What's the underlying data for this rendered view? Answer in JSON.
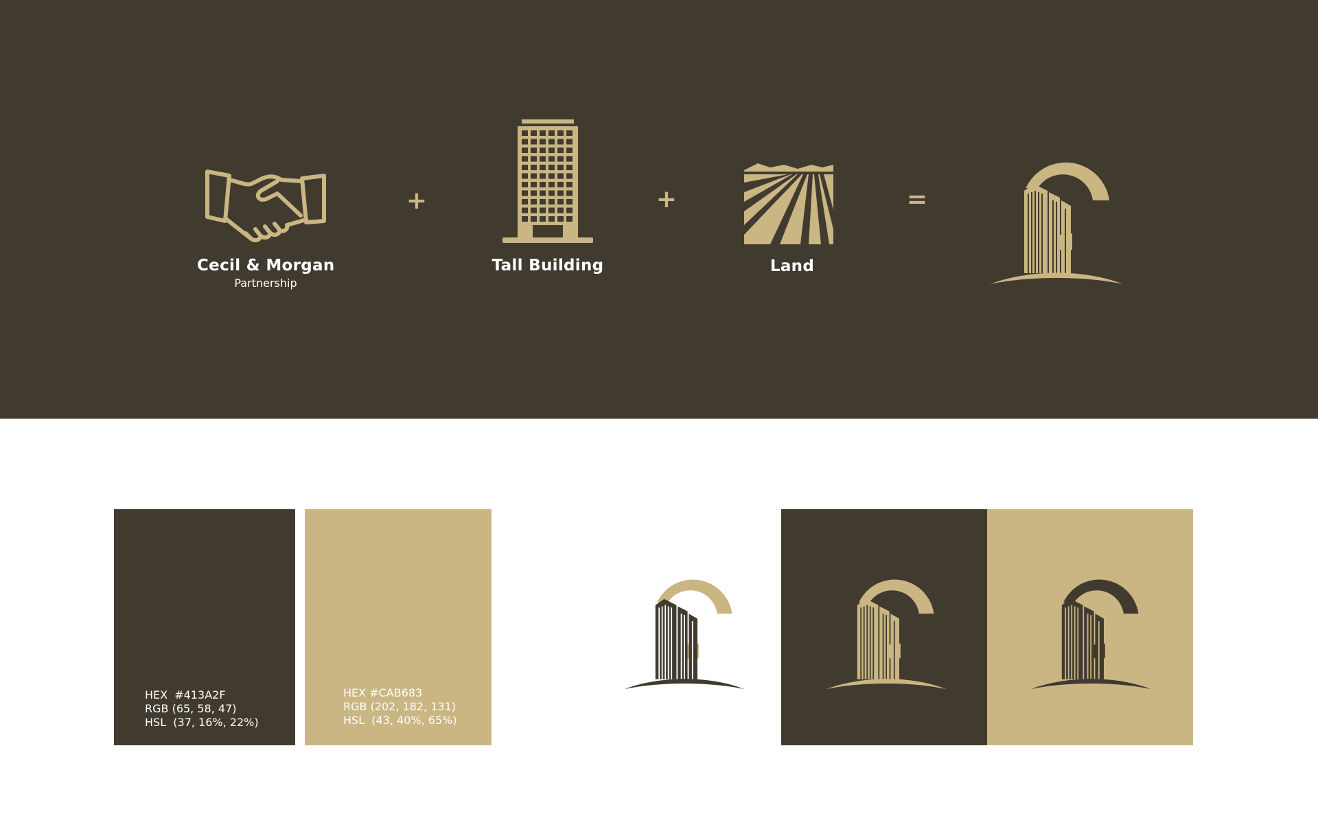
{
  "concept": {
    "items": [
      {
        "label": "Cecil & Morgan",
        "sublabel": "Partnership",
        "icon": "handshake-icon"
      },
      {
        "label": "Tall Building",
        "icon": "tall-building-icon"
      },
      {
        "label": "Land",
        "icon": "land-field-icon"
      }
    ],
    "operators": [
      "+",
      "+",
      "="
    ],
    "result_icon": "building-c-logo-icon"
  },
  "palette": [
    {
      "hex": "HEX  #413A2F",
      "rgb": "RGB (65, 58, 47)",
      "hsl": "HSL  (37, 16%, 22%)",
      "color": "#413A2F",
      "text_color": "#FFFFFF"
    },
    {
      "hex": "HEX #CAB683",
      "rgb": "RGB (202, 182, 131)",
      "hsl": "HSL  (43, 40%, 65%)",
      "color": "#CAB683",
      "text_color": "#FFFFFF"
    }
  ],
  "colors": {
    "dark": "#413A2F",
    "gold": "#CAB683",
    "white": "#FFFFFF"
  }
}
